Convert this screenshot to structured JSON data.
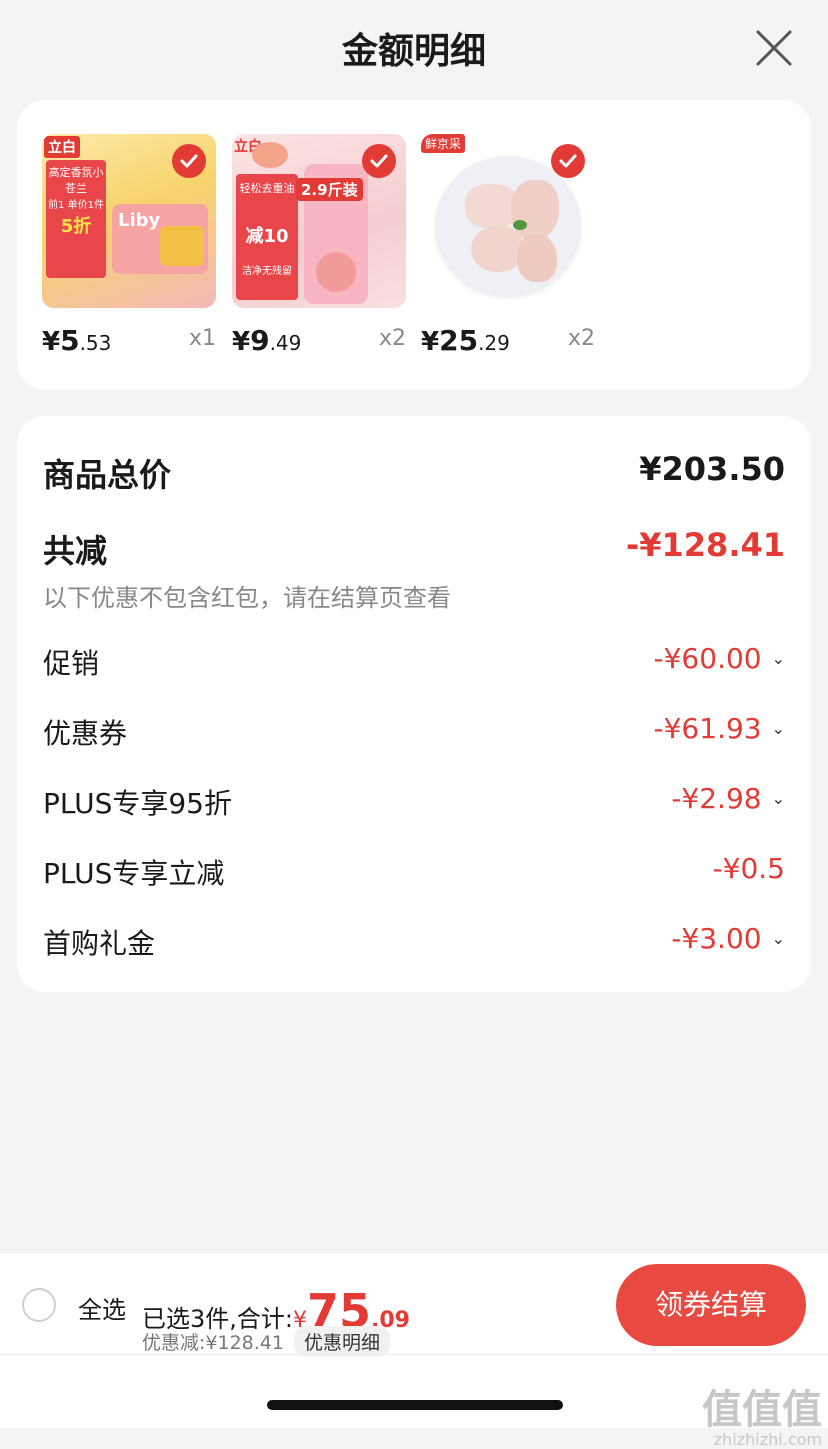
{
  "header": {
    "title": "金额明细"
  },
  "products": [
    {
      "brand": "立白",
      "price_int": "5",
      "price_dec": ".53",
      "currency": "¥",
      "qty": "x1",
      "img_texts": [
        "高定香氛小苍兰",
        "前1 单价1件",
        "5折",
        "Liby"
      ]
    },
    {
      "brand": "立白",
      "price_int": "9",
      "price_dec": ".49",
      "currency": "¥",
      "qty": "x2",
      "img_texts": [
        "2.9斤装",
        "轻松去重油",
        "减10",
        "洁净无残留"
      ]
    },
    {
      "brand": "鲜京采",
      "price_int": "25",
      "price_dec": ".29",
      "currency": "¥",
      "qty": "x2",
      "img_texts": []
    }
  ],
  "summary": {
    "total_label": "商品总价",
    "total_value": "¥203.50",
    "reduce_label": "共减",
    "reduce_value": "-¥128.41",
    "note": "以下优惠不包含红包，请在结算页查看",
    "discounts": [
      {
        "label": "促销",
        "value": "-¥60.00",
        "expandable": true
      },
      {
        "label": "优惠券",
        "value": "-¥61.93",
        "expandable": true
      },
      {
        "label": "PLUS专享95折",
        "value": "-¥2.98",
        "expandable": true
      },
      {
        "label": "PLUS专享立减",
        "value": "-¥0.5",
        "expandable": false
      },
      {
        "label": "首购礼金",
        "value": "-¥3.00",
        "expandable": true
      }
    ]
  },
  "footer": {
    "select_all": "全选",
    "selected_text": "已选3件,合计:",
    "currency": "¥",
    "total_int": "75",
    "total_dec": ".09",
    "savings": "优惠减:¥128.41",
    "detail_link": "优惠明细",
    "checkout": "领券结算"
  },
  "watermark": {
    "logo": "值值值",
    "url": "zhizhizhi.com"
  },
  "colors": {
    "accent": "#e23b35",
    "checkout_bg": "#e84a41"
  }
}
